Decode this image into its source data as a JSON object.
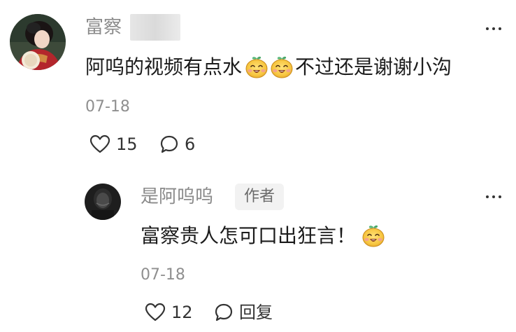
{
  "comment": {
    "username": "富察",
    "text_part1": "阿呜的视频有点水",
    "emoji": "grin-emoji",
    "text_part2": "不过还是谢谢小沟",
    "date": "07-18",
    "likes": "15",
    "replies": "6"
  },
  "reply": {
    "username": "是阿呜呜",
    "badge": "作者",
    "text": "富察贵人怎可口出狂言！",
    "emoji": "grin-emoji",
    "date": "07-18",
    "likes": "12",
    "reply_label": "回复"
  },
  "colors": {
    "username": "#8a8a8a",
    "text": "#1b1b1b",
    "date": "#8f8f8f",
    "badge_bg": "#f2f2f2",
    "emoji_yellow": "#f5c33b",
    "emoji_green": "#5ab87a"
  },
  "icons": {
    "like": "heart-outline-icon",
    "comment": "speech-bubble-icon",
    "more": "ellipsis-icon"
  }
}
